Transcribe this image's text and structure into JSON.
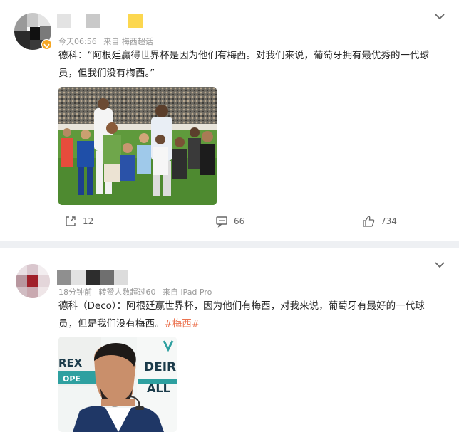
{
  "posts": [
    {
      "meta_time": "今天06:56",
      "meta_source": "来自 梅西超话",
      "text": "德科：“阿根廷赢得世界杯是因为他们有梅西。对我们来说，葡萄牙拥有最优秀的一代球员，但我们没有梅西。”",
      "actions": {
        "repost": "12",
        "comment": "66",
        "like": "734"
      }
    },
    {
      "meta_time": "18分钟前",
      "meta_reposts": "转赞人数超过60",
      "meta_source": "来自 iPad Pro",
      "text": "德科（Deco）：阿根廷赢世界杯，因为他们有梅西，对我来说，葡萄牙有最好的一代球员，但是我们没有梅西。",
      "hashtag": "#梅西#",
      "photo_text": {
        "left": "REX",
        "right": "DEIR",
        "right2": "ALL",
        "bottom": "OPE"
      }
    }
  ],
  "colors": {
    "accent": "#eb7350",
    "badge": "#f5a623",
    "page_bg": "#eef0f3"
  },
  "icons": [
    "chevron-down-icon",
    "share-icon",
    "comment-icon",
    "like-icon",
    "verified-badge-icon"
  ]
}
